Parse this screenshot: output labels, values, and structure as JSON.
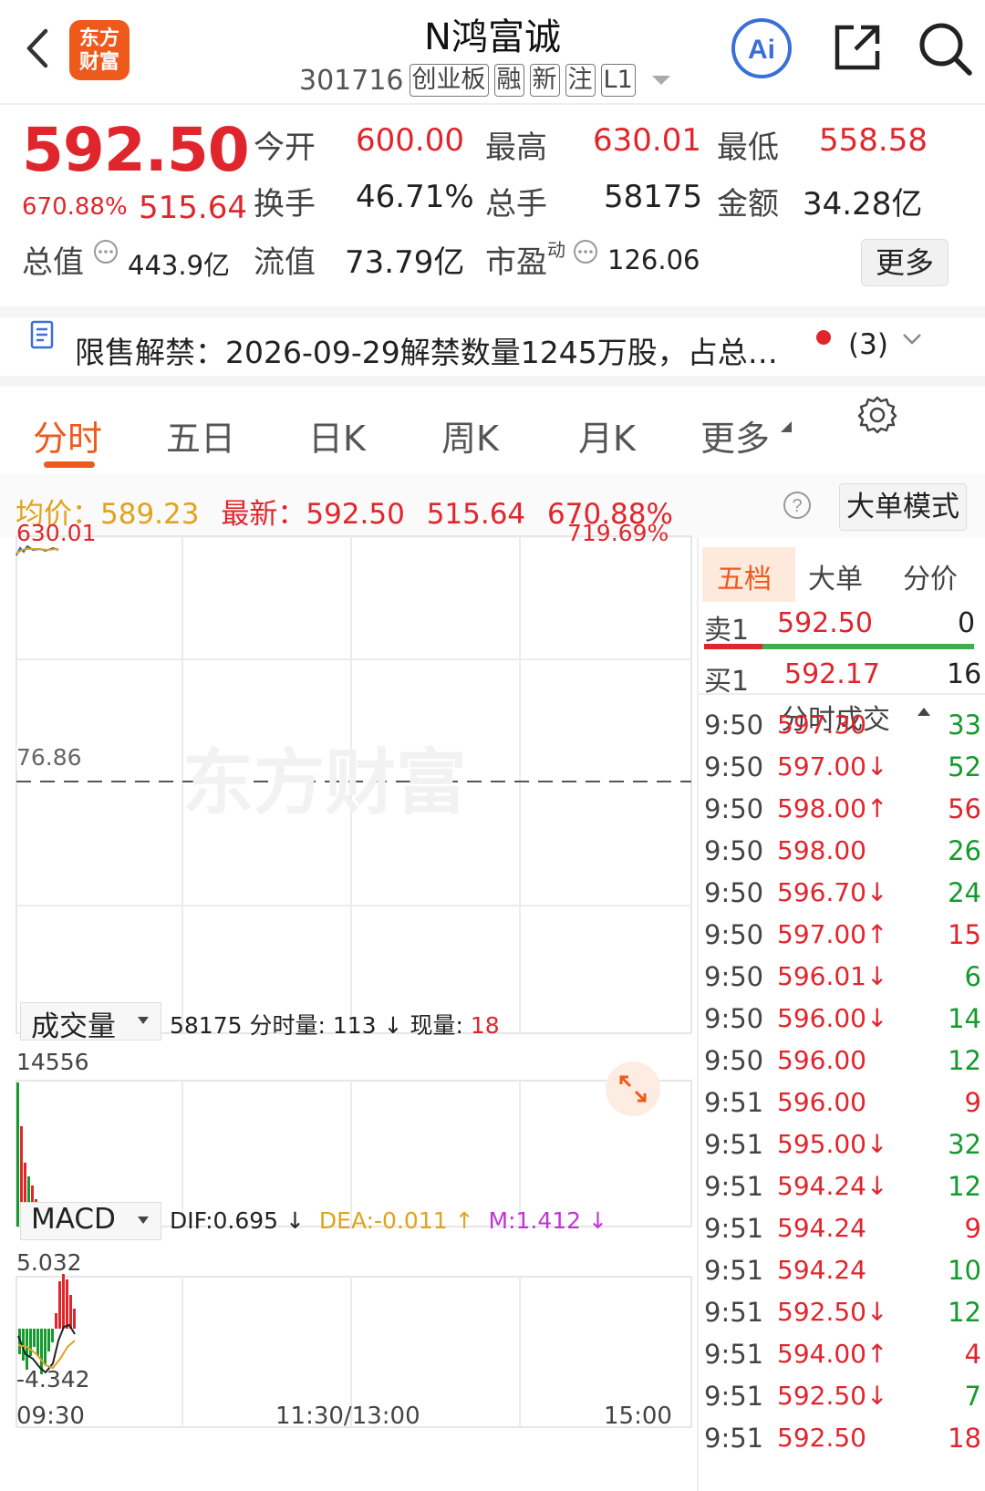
{
  "header": {
    "title": "N鸿富诚",
    "code": "301716",
    "tags": [
      "创业板",
      "融",
      "新",
      "注",
      "L1"
    ],
    "logo_text": "东方\n财富",
    "ai_label": "Ai"
  },
  "quote": {
    "price": "592.50",
    "change_pct": "670.88%",
    "change": "515.64",
    "open_label": "今开",
    "open": "600.00",
    "high_label": "最高",
    "high": "630.01",
    "low_label": "最低",
    "low": "558.58",
    "turnover_label": "换手",
    "turnover": "46.71%",
    "volume_label": "总手",
    "volume": "58175",
    "amount_label": "金额",
    "amount": "34.28亿",
    "mcap_label": "总值",
    "mcap": "443.9亿",
    "float_label": "流值",
    "float": "73.79亿",
    "pe_label": "市盈",
    "pe_sup": "动",
    "pe": "126.06",
    "more": "更多"
  },
  "notice": {
    "text": "限售解禁：2026-09-29解禁数量1245万股，占总…",
    "count": "(3)"
  },
  "tabs": [
    "分时",
    "五日",
    "日K",
    "周K",
    "月K",
    "更多"
  ],
  "info": {
    "avg_label": "均价：",
    "avg": "589.23",
    "latest_label": "最新：",
    "latest": "592.50",
    "chg": "515.64",
    "pct": "670.88%",
    "big_order": "大单模式"
  },
  "chart": {
    "top_price": "630.01",
    "top_pct": "719.69%",
    "base_price": "76.86",
    "watermark": "东方财富"
  },
  "volume_panel": {
    "label": "成交量",
    "total": "58175",
    "fs_label": "分时量:",
    "fs": "113",
    "now_label": "现量:",
    "now": "18",
    "max": "14556"
  },
  "macd_panel": {
    "label": "MACD",
    "dif": "DIF:0.695",
    "dea": "DEA:-0.011",
    "m": "M:1.412",
    "max": "5.032",
    "min": "-4.342"
  },
  "time_axis": [
    "09:30",
    "11:30/13:00",
    "15:00"
  ],
  "right": {
    "tabs": [
      "五档",
      "大单",
      "分价"
    ],
    "sell1": {
      "label": "卖1",
      "price": "592.50",
      "vol": "0"
    },
    "buy1": {
      "label": "买1",
      "price": "592.17",
      "vol": "16"
    },
    "ticks_title": "分时成交",
    "ticks": [
      {
        "t": "9:50",
        "p": "597.30",
        "a": "",
        "v": "33",
        "c": "g"
      },
      {
        "t": "9:50",
        "p": "597.00",
        "a": "↓",
        "v": "52",
        "c": "g"
      },
      {
        "t": "9:50",
        "p": "598.00",
        "a": "↑",
        "v": "56",
        "c": "r"
      },
      {
        "t": "9:50",
        "p": "598.00",
        "a": "",
        "v": "26",
        "c": "g"
      },
      {
        "t": "9:50",
        "p": "596.70",
        "a": "↓",
        "v": "24",
        "c": "g"
      },
      {
        "t": "9:50",
        "p": "597.00",
        "a": "↑",
        "v": "15",
        "c": "r"
      },
      {
        "t": "9:50",
        "p": "596.01",
        "a": "↓",
        "v": "6",
        "c": "g"
      },
      {
        "t": "9:50",
        "p": "596.00",
        "a": "↓",
        "v": "14",
        "c": "g"
      },
      {
        "t": "9:50",
        "p": "596.00",
        "a": "",
        "v": "12",
        "c": "g"
      },
      {
        "t": "9:51",
        "p": "596.00",
        "a": "",
        "v": "9",
        "c": "r"
      },
      {
        "t": "9:51",
        "p": "595.00",
        "a": "↓",
        "v": "32",
        "c": "g"
      },
      {
        "t": "9:51",
        "p": "594.24",
        "a": "↓",
        "v": "12",
        "c": "g"
      },
      {
        "t": "9:51",
        "p": "594.24",
        "a": "",
        "v": "9",
        "c": "r"
      },
      {
        "t": "9:51",
        "p": "594.24",
        "a": "",
        "v": "10",
        "c": "g"
      },
      {
        "t": "9:51",
        "p": "592.50",
        "a": "↓",
        "v": "12",
        "c": "g"
      },
      {
        "t": "9:51",
        "p": "594.00",
        "a": "↑",
        "v": "4",
        "c": "r"
      },
      {
        "t": "9:51",
        "p": "592.50",
        "a": "↓",
        "v": "7",
        "c": "g"
      },
      {
        "t": "9:51",
        "p": "592.50",
        "a": "",
        "v": "18",
        "c": "r"
      }
    ]
  },
  "colors": {
    "up": "#e0262d",
    "down": "#159a2f",
    "accent": "#ee5a1c",
    "avg": "#e0a31e"
  }
}
